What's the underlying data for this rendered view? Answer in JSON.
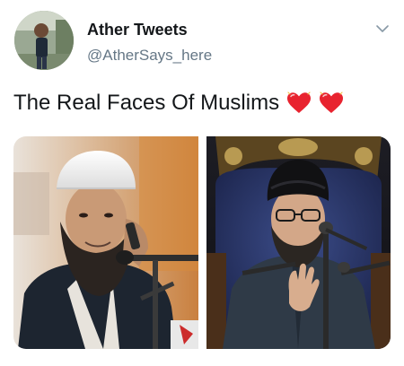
{
  "tweet": {
    "author": {
      "display_name": "Ather Tweets",
      "handle": "@AtherSays_here",
      "avatar_icon": "user-avatar"
    },
    "menu_icon": "chevron-down-icon",
    "text": "The Real Faces Of Muslims",
    "emojis": [
      "heart-icon",
      "heart-icon"
    ],
    "colors": {
      "heart": "#e8232f",
      "name": "#14171a",
      "handle": "#657786",
      "chevron": "#8899a6"
    },
    "media": {
      "count": 2,
      "photos": [
        {
          "icon": "man-with-white-cap-on-phone-photo"
        },
        {
          "icon": "man-with-black-turban-speaking-photo"
        }
      ]
    }
  }
}
